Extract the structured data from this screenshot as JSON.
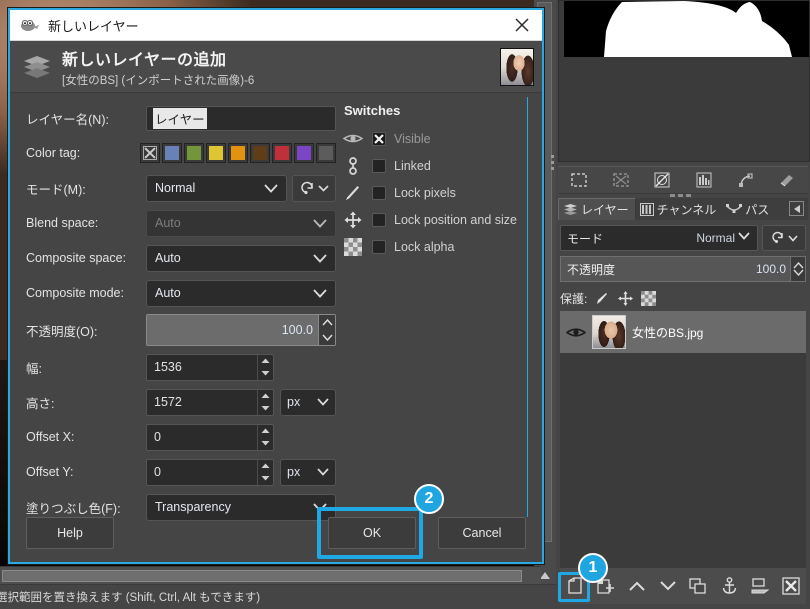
{
  "dialog": {
    "window_title": "新しいレイヤー",
    "header_title": "新しいレイヤーの追加",
    "header_subtitle": "[女性のBS] (インポートされた画像)-6",
    "close_icon": "close-icon",
    "fields": {
      "layer_name_label": "レイヤー名(N):",
      "layer_name_value": "レイヤー",
      "color_tag_label": "Color tag:",
      "mode_label": "モード(M):",
      "mode_value": "Normal",
      "blend_space_label": "Blend space:",
      "blend_space_value": "Auto",
      "composite_space_label": "Composite space:",
      "composite_space_value": "Auto",
      "composite_mode_label": "Composite mode:",
      "composite_mode_value": "Auto",
      "opacity_label": "不透明度(O):",
      "opacity_value": "100.0",
      "width_label": "幅:",
      "width_value": "1536",
      "height_label": "高さ:",
      "height_value": "1572",
      "height_unit": "px",
      "offset_x_label": "Offset X:",
      "offset_x_value": "0",
      "offset_y_label": "Offset Y:",
      "offset_y_value": "0",
      "offset_y_unit": "px",
      "fill_label": "塗りつぶし色(F):",
      "fill_value": "Transparency"
    },
    "color_tags": [
      {
        "name": "none",
        "color": "#3a3a3a"
      },
      {
        "name": "blue",
        "color": "#6a81b8"
      },
      {
        "name": "green",
        "color": "#74963a"
      },
      {
        "name": "yellow",
        "color": "#ddc534"
      },
      {
        "name": "orange",
        "color": "#e2920f"
      },
      {
        "name": "brown",
        "color": "#5f3d18"
      },
      {
        "name": "red",
        "color": "#c0303a"
      },
      {
        "name": "violet",
        "color": "#7b45c4"
      },
      {
        "name": "gray",
        "color": "#5c5c5c"
      }
    ],
    "switches": {
      "title": "Switches",
      "items": [
        {
          "label": "Visible",
          "icon": "eye-icon",
          "checked": true,
          "dimmed": true
        },
        {
          "label": "Linked",
          "icon": "chain-link-icon",
          "checked": false,
          "dimmed": false
        },
        {
          "label": "Lock pixels",
          "icon": "paintbrush-icon",
          "checked": false,
          "dimmed": false
        },
        {
          "label": "Lock position and size",
          "icon": "move-arrows-icon",
          "checked": false,
          "dimmed": false
        },
        {
          "label": "Lock alpha",
          "icon": "checkerboard-icon",
          "checked": false,
          "dimmed": false
        }
      ]
    },
    "buttons": {
      "help": "Help",
      "ok": "OK",
      "cancel": "Cancel"
    }
  },
  "annotations": {
    "badge_one": "1",
    "badge_two": "2",
    "accent_color": "#20a8e4"
  },
  "status_bar": {
    "text": "選択範囲を置き換えます (Shift, Ctrl, Alt もできます)"
  },
  "dock": {
    "switcher_icons": [
      "selection-icon",
      "selection-none-icon",
      "pointer-icon",
      "histogram-icon",
      "paths-icon",
      "undo-history-icon"
    ],
    "tabs": [
      {
        "label": "レイヤー",
        "icon": "layers-icon",
        "active": true
      },
      {
        "label": "チャンネル",
        "icon": "channels-icon",
        "active": false
      },
      {
        "label": "パス",
        "icon": "paths-icon",
        "active": false
      }
    ],
    "collapse_icon": "chevron-left-icon",
    "mode_label": "モード",
    "mode_value": "Normal",
    "reset_icon": "reset-icon",
    "opacity_label": "不透明度",
    "opacity_value": "100.0",
    "lock_label": "保護:",
    "lock_icons": [
      "paintbrush-icon",
      "move-arrows-icon",
      "checkerboard-icon"
    ],
    "layers": [
      {
        "name": "女性のBS.jpg",
        "visible": true,
        "selected": true,
        "visibility_icon": "eye-icon"
      }
    ],
    "bottom_buttons": [
      "new-layer-icon",
      "new-layer-group-icon",
      "raise-layer-icon",
      "lower-layer-icon",
      "duplicate-layer-icon",
      "anchor-layer-icon",
      "merge-down-icon",
      "delete-layer-icon"
    ]
  }
}
